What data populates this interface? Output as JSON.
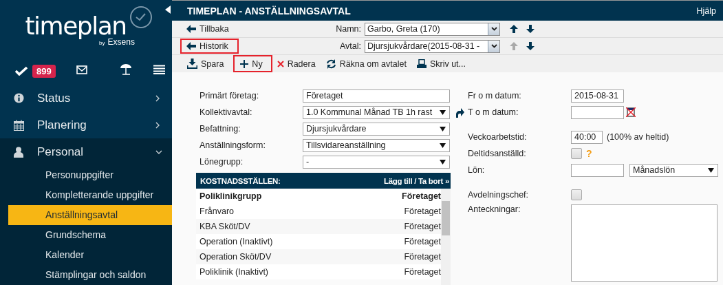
{
  "sidebar": {
    "logo": "timeplan",
    "byline": "by",
    "brand": "Exsens",
    "task_count": "899",
    "nav": [
      {
        "label": "Status",
        "expanded": false
      },
      {
        "label": "Planering",
        "expanded": false
      },
      {
        "label": "Personal",
        "expanded": true,
        "children": [
          {
            "label": "Personuppgifter",
            "selected": false
          },
          {
            "label": "Kompletterande uppgifter",
            "selected": false
          },
          {
            "label": "Anställningsavtal",
            "selected": true
          },
          {
            "label": "Grundschema",
            "selected": false
          },
          {
            "label": "Kalender",
            "selected": false
          },
          {
            "label": "Stämplingar och saldon",
            "selected": false
          }
        ]
      }
    ]
  },
  "header": {
    "title": "TIMEPLAN - ANSTÄLLNINGSAVTAL",
    "help": "Hjälp"
  },
  "nav_links": [
    {
      "label": "Tillbaka",
      "highlighted": false
    },
    {
      "label": "Historik",
      "highlighted": true
    }
  ],
  "selectors": [
    {
      "label": "Namn:",
      "value": "Garbo, Greta (170)",
      "prev_disabled": false,
      "next_disabled": false
    },
    {
      "label": "Avtal:",
      "value": "Djursjukvårdare(2015-08-31 -",
      "prev_disabled": true,
      "next_disabled": false
    }
  ],
  "toolbar": [
    {
      "label": "Spara",
      "highlighted": false
    },
    {
      "label": "Ny",
      "highlighted": true
    },
    {
      "label": "Radera",
      "highlighted": false
    },
    {
      "label": "Räkna om avtalet",
      "highlighted": false
    },
    {
      "label": "Skriv ut...",
      "highlighted": false
    }
  ],
  "left_fields": [
    {
      "label": "Primärt företag:",
      "kind": "text",
      "value": "Företaget"
    },
    {
      "label": "Kollektivavtal:",
      "kind": "select",
      "value": "1.0 Kommunal Månad TB 1h rast"
    },
    {
      "label": "Befattning:",
      "kind": "select",
      "value": "Djursjukvårdare"
    },
    {
      "label": "Anställningsform:",
      "kind": "select",
      "value": "Tillsvidareanställning"
    },
    {
      "label": "Lönegrupp:",
      "kind": "select",
      "value": "-"
    }
  ],
  "cost_centers": {
    "title": "KOSTNADSSTÄLLEN:",
    "action": "Lägg till / Ta bort »",
    "rows": [
      {
        "name": "Poliklinikgrupp",
        "company": "Företaget",
        "primary": true
      },
      {
        "name": "Frånvaro",
        "company": "Företaget",
        "primary": false
      },
      {
        "name": "KBA Sköt/DV",
        "company": "Företaget",
        "primary": false
      },
      {
        "name": "Operation (Inaktivt)",
        "company": "Företaget",
        "primary": false
      },
      {
        "name": "Operation Sköt/DV",
        "company": "Företaget",
        "primary": false
      },
      {
        "name": "Poliklinik (Inaktivt)",
        "company": "Företaget",
        "primary": false
      }
    ]
  },
  "right_fields": [
    {
      "label": "Fr o m datum:",
      "kind": "text",
      "value": "2015-08-31"
    },
    {
      "label": "T o m datum:",
      "kind": "date"
    },
    {
      "label": "Veckoarbetstid:",
      "kind": "text",
      "value": "40:00",
      "note": "(100% av heltid)"
    },
    {
      "label": "Deltidsanställd:",
      "kind": "checkbox",
      "checked": false,
      "help": "?"
    },
    {
      "label": "Lön:",
      "kind": "text",
      "select_value": "Månadslön"
    },
    {
      "label": "Avdelningschef:",
      "kind": "checkbox",
      "checked": false
    },
    {
      "label": "Anteckningar:",
      "kind": "textarea"
    }
  ]
}
